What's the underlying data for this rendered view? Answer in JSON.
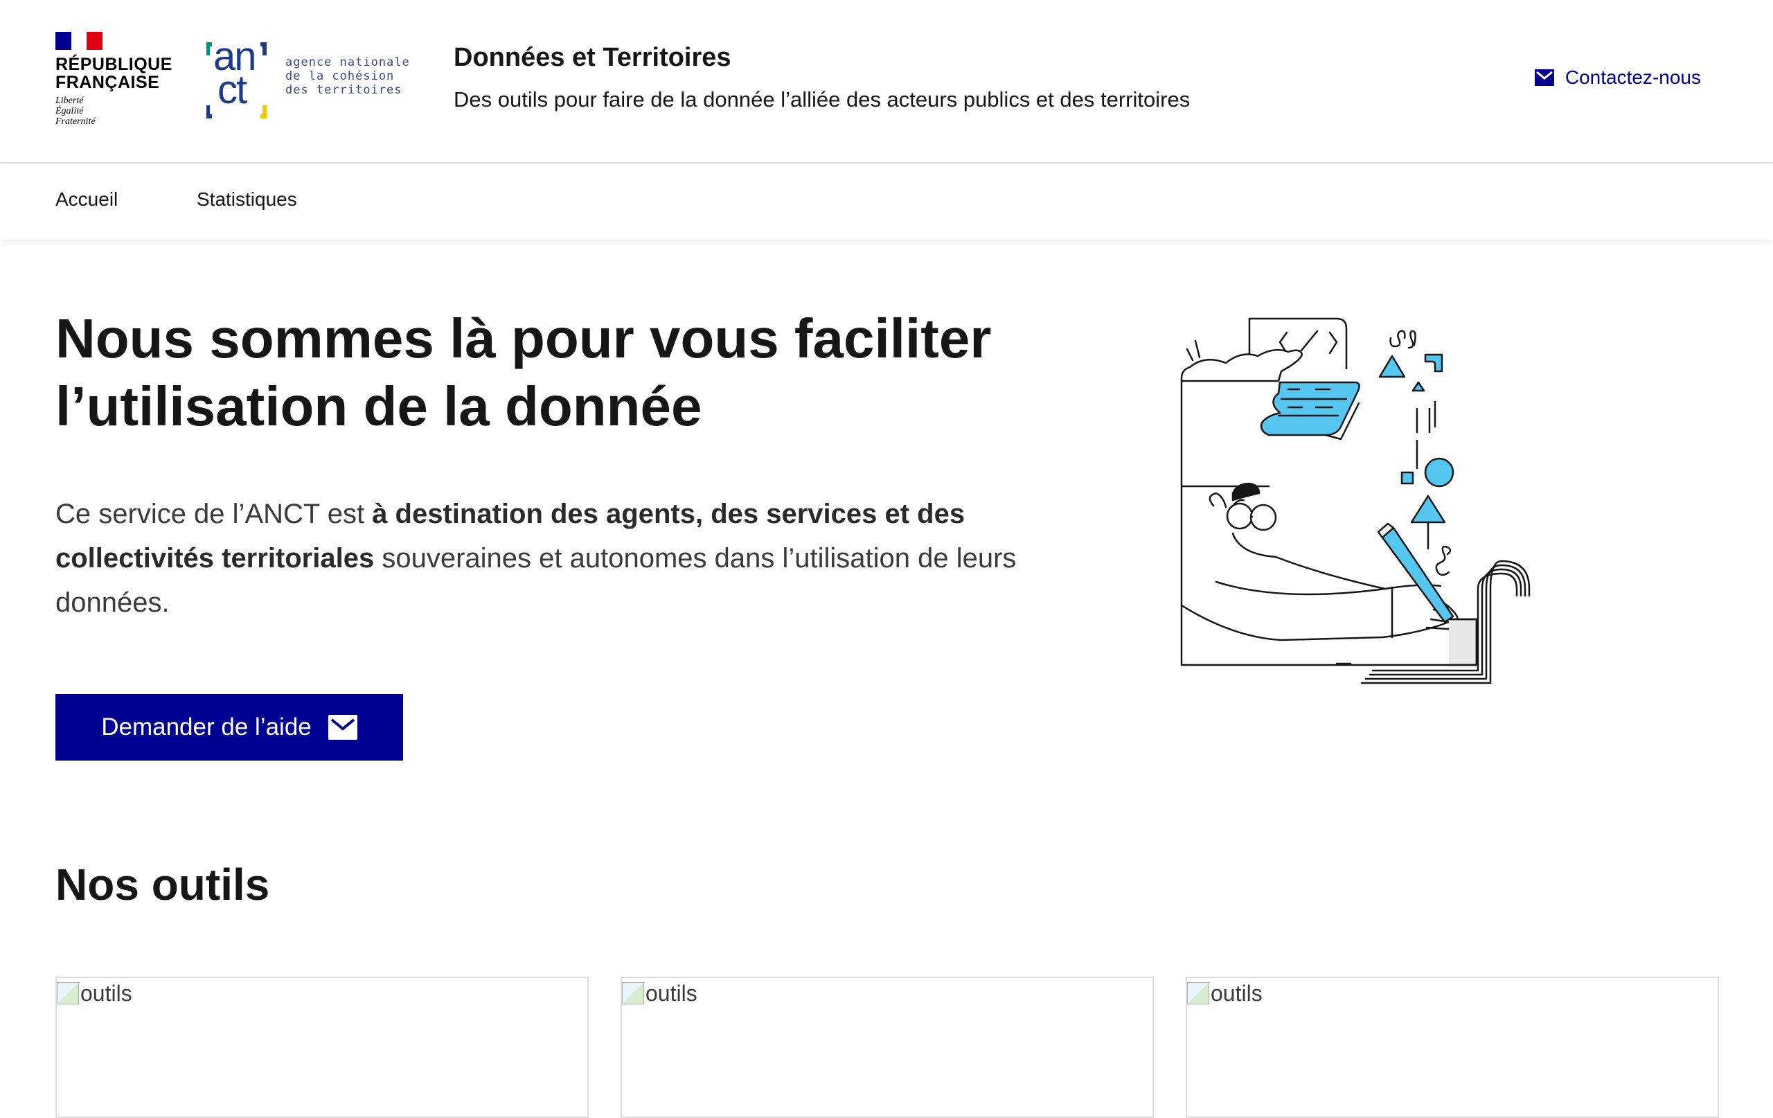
{
  "header": {
    "republique_line1": "RÉPUBLIQUE",
    "republique_line2": "FRANÇAISE",
    "motto": [
      "Liberté",
      "Égalité",
      "Fraternité"
    ],
    "anct_letters_top": "an",
    "anct_letters_bottom": "ct",
    "anct_text": [
      "agence nationale",
      "de la cohésion",
      "des territoires"
    ],
    "site_title": "Données et Territoires",
    "tagline": "Des outils pour faire de la donnée l’alliée des acteurs publics et des territoires",
    "contact_label": "Contactez-nous"
  },
  "nav": {
    "items": [
      {
        "label": "Accueil"
      },
      {
        "label": "Statistiques"
      }
    ]
  },
  "hero": {
    "title_line1": "Nous sommes là pour vous faciliter",
    "title_line2": "l’utilisation de la donnée",
    "text_part1": "Ce service de l’ANCT est ",
    "text_bold": "à destination des agents, des services et des collectivités territoriales",
    "text_part2": " souveraines et autonomes dans l’utilisation de leurs données.",
    "cta_label": "Demander de l’aide"
  },
  "tools": {
    "title": "Nos outils",
    "cards": [
      {
        "alt": "outils"
      },
      {
        "alt": "outils"
      },
      {
        "alt": "outils"
      }
    ]
  },
  "colors": {
    "primary_blue": "#000091",
    "illustration_accent": "#55c6f0",
    "flag_blue": "#000091",
    "flag_red": "#e1000f"
  }
}
